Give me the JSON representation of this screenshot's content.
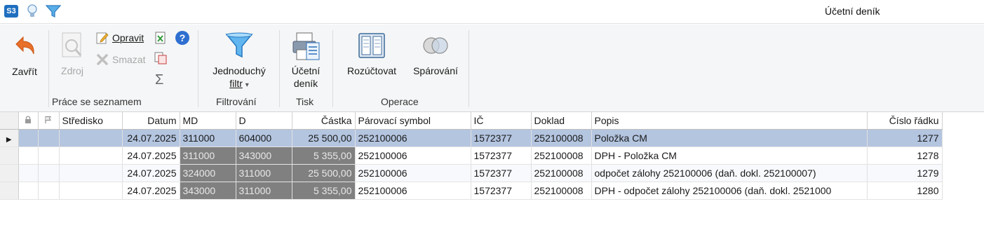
{
  "app": {
    "logo_text": "S3",
    "window_title": "Účetní deník"
  },
  "ribbon": {
    "zavrit": "Zavřít",
    "zdroj": "Zdroj",
    "opravit": "Opravit",
    "smazat": "Smazat",
    "sigma": "Σ",
    "group_prace": "Práce se seznamem",
    "jednoduchy_line1": "Jednoduchý",
    "jednoduchy_line2": "filtr",
    "dropdown_arrow": "▾",
    "group_filtrovani": "Filtrování",
    "ucetni_line1": "Účetní",
    "ucetni_line2": "deník",
    "group_tisk": "Tisk",
    "rozuctovat": "Rozúčtovat",
    "sparovani": "Spárování",
    "group_operace": "Operace",
    "help_glyph": "?"
  },
  "grid": {
    "columns": {
      "stredisko": "Středisko",
      "datum": "Datum",
      "md": "MD",
      "d": "D",
      "castka": "Částka",
      "parovaci": "Párovací symbol",
      "ic": "IČ",
      "doklad": "Doklad",
      "popis": "Popis",
      "cislo": "Číslo řádku"
    },
    "row_pointer": "▶",
    "rows": [
      {
        "stredisko": "",
        "datum": "24.07.2025",
        "md": "311000",
        "d": "604000",
        "castka": "25 500,00",
        "parovaci": "252100006",
        "ic": "1572377",
        "doklad": "252100008",
        "popis": "Položka CM",
        "cislo": "1277"
      },
      {
        "stredisko": "",
        "datum": "24.07.2025",
        "md": "311000",
        "d": "343000",
        "castka": "5 355,00",
        "parovaci": "252100006",
        "ic": "1572377",
        "doklad": "252100008",
        "popis": "DPH - Položka CM",
        "cislo": "1278"
      },
      {
        "stredisko": "",
        "datum": "24.07.2025",
        "md": "324000",
        "d": "311000",
        "castka": "25 500,00",
        "parovaci": "252100006",
        "ic": "1572377",
        "doklad": "252100008",
        "popis": "odpočet zálohy 252100006 (daň. dokl. 252100007)",
        "cislo": "1279"
      },
      {
        "stredisko": "",
        "datum": "24.07.2025",
        "md": "343000",
        "d": "311000",
        "castka": "5 355,00",
        "parovaci": "252100006",
        "ic": "1572377",
        "doklad": "252100008",
        "popis": "DPH - odpočet zálohy 252100006 (daň. dokl. 2521000",
        "cislo": "1280"
      }
    ]
  },
  "colors": {
    "selected_row": "#b4c5e0",
    "readonly_cell": "#808080",
    "accent_blue": "#1f6fbf"
  }
}
